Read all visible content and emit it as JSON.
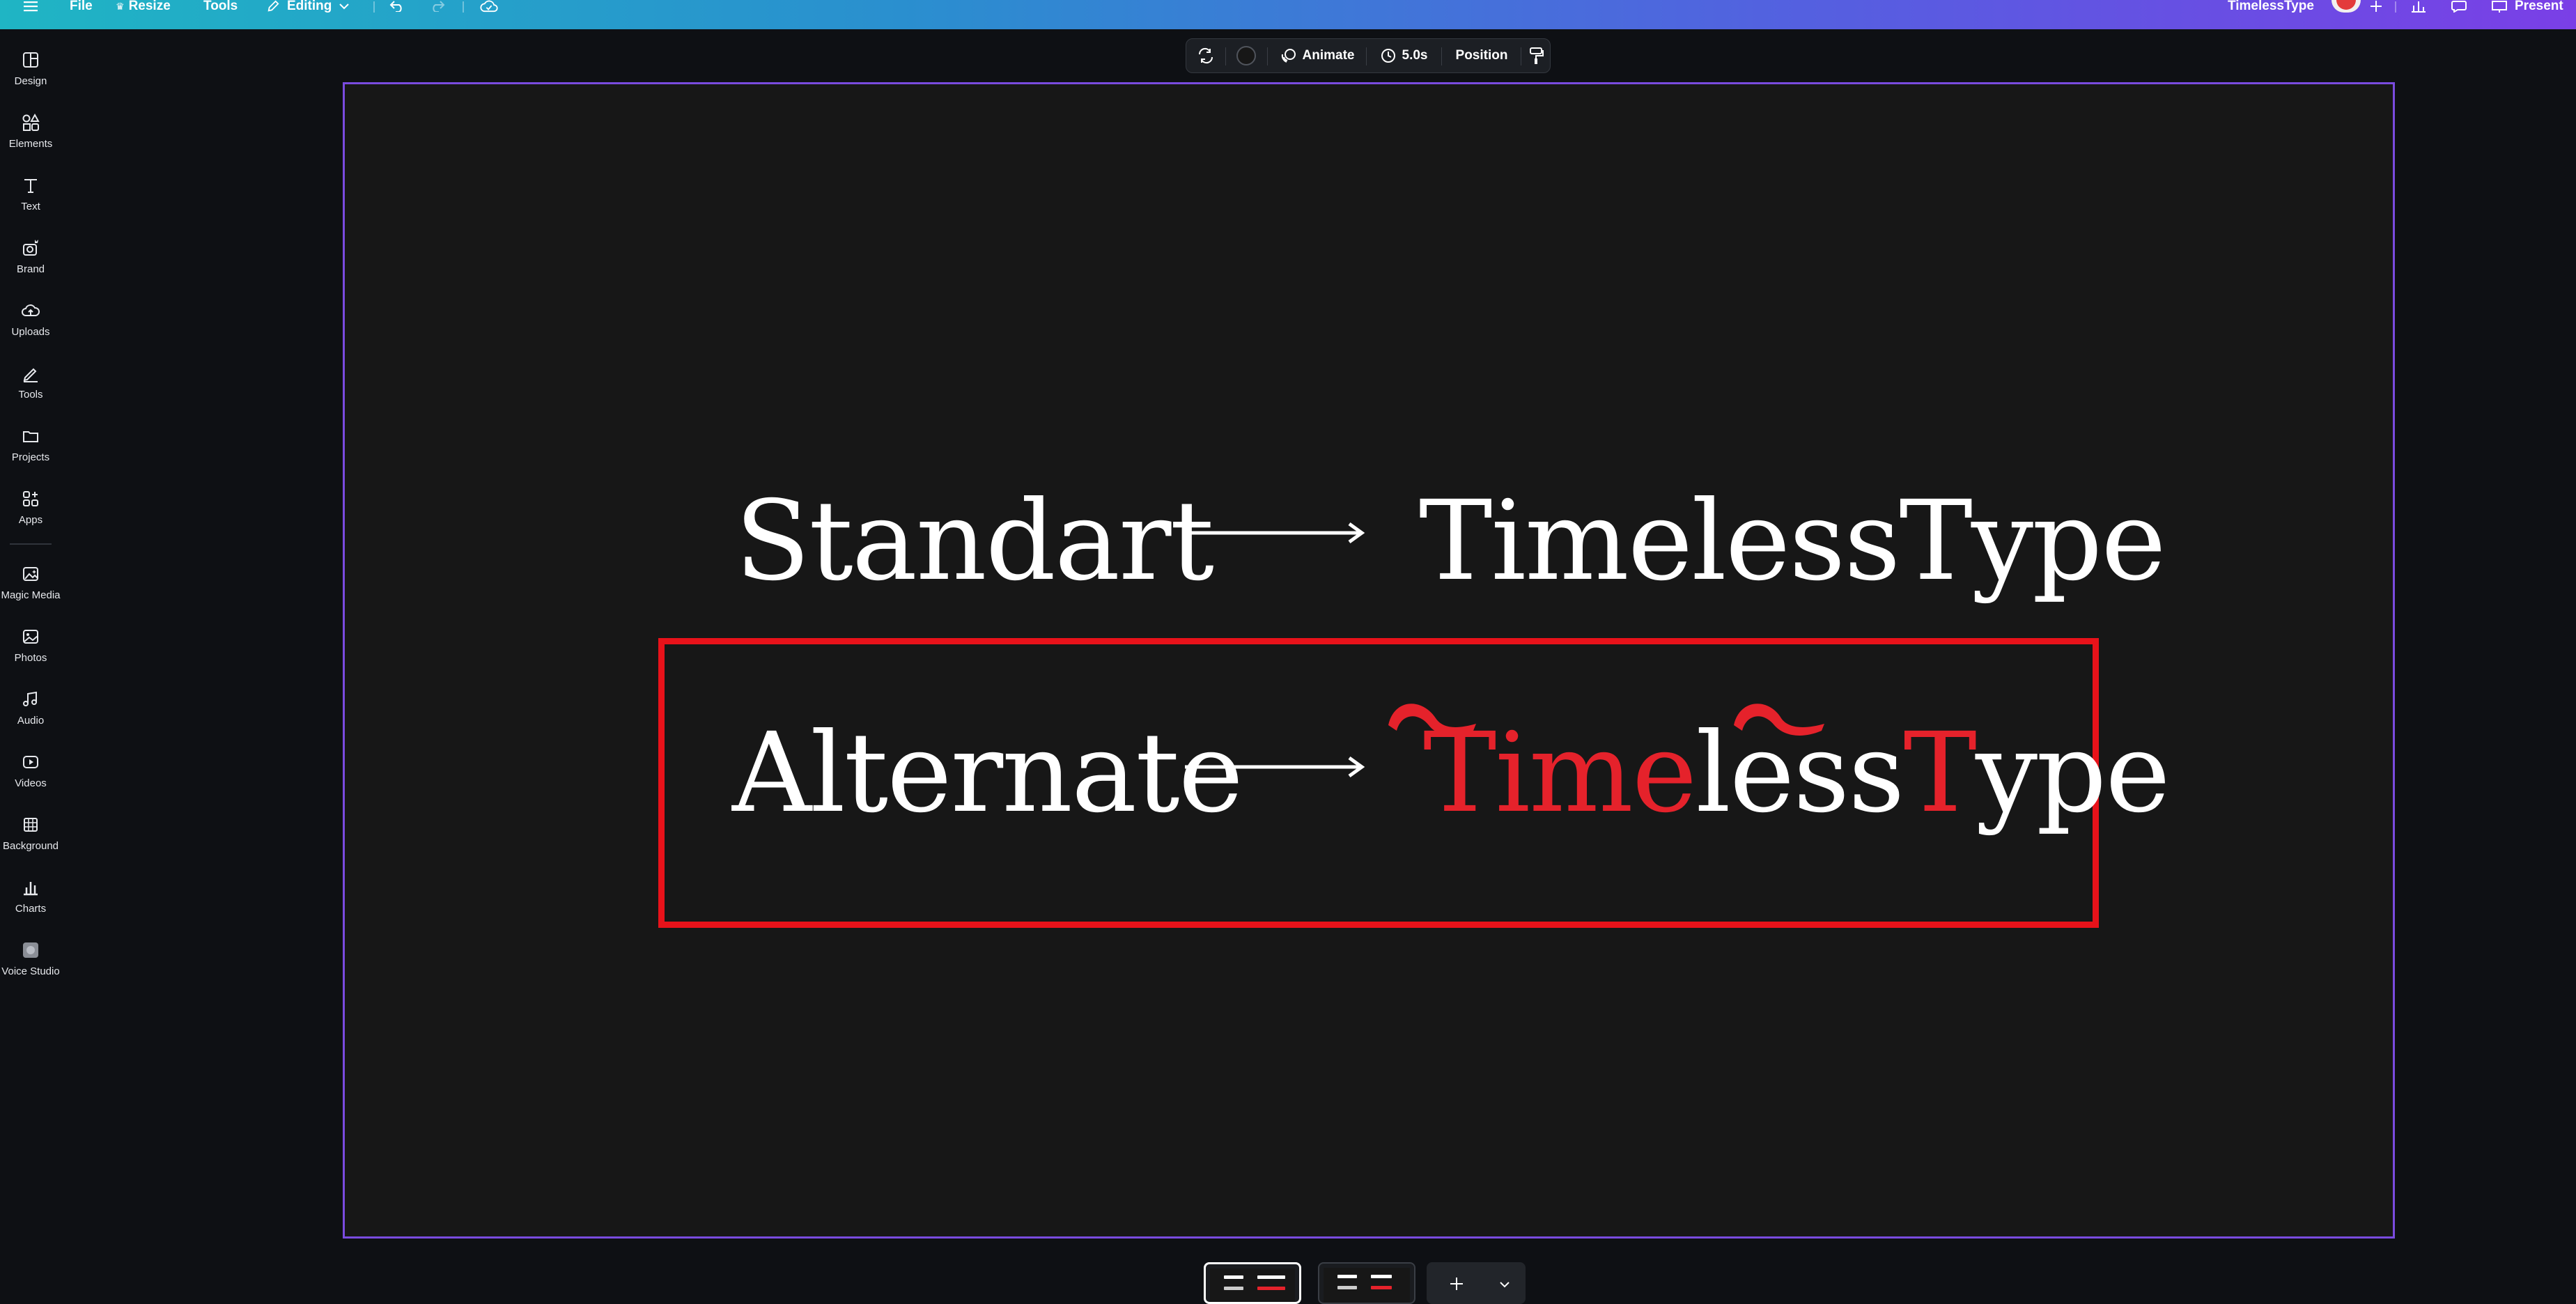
{
  "topbar": {
    "menu_icon": "hamburger-icon",
    "file_label": "File",
    "resize_label": "Resize",
    "tools_label": "Tools",
    "editing_label": "Editing",
    "design_title": "TimelessType",
    "present_label": "Present"
  },
  "sidebar": {
    "items": [
      {
        "label": "Design",
        "icon": "design-icon"
      },
      {
        "label": "Elements",
        "icon": "elements-icon"
      },
      {
        "label": "Text",
        "icon": "text-icon"
      },
      {
        "label": "Brand",
        "icon": "brand-icon"
      },
      {
        "label": "Uploads",
        "icon": "uploads-icon"
      },
      {
        "label": "Tools",
        "icon": "tools-icon"
      },
      {
        "label": "Projects",
        "icon": "projects-icon"
      },
      {
        "label": "Apps",
        "icon": "apps-icon"
      },
      {
        "label": "Magic Media",
        "icon": "magic-media-icon"
      },
      {
        "label": "Photos",
        "icon": "photos-icon"
      },
      {
        "label": "Audio",
        "icon": "audio-icon"
      },
      {
        "label": "Videos",
        "icon": "videos-icon"
      },
      {
        "label": "Background",
        "icon": "background-icon"
      },
      {
        "label": "Charts",
        "icon": "charts-icon"
      },
      {
        "label": "Voice Studio",
        "icon": "voice-studio-icon"
      }
    ]
  },
  "floating_toolbar": {
    "animate_label": "Animate",
    "duration_label": "5.0s",
    "position_label": "Position"
  },
  "slide": {
    "row1_left": "Standart",
    "row1_right": "TimelessType",
    "row2_left": "Alternate",
    "row2_right_parts": [
      {
        "text": "Ti",
        "color": "red"
      },
      {
        "text": "m",
        "color": "red"
      },
      {
        "text": "e",
        "color": "red"
      },
      {
        "text": "less",
        "color": "white"
      },
      {
        "text": "T",
        "color": "red"
      },
      {
        "text": "ype",
        "color": "white"
      }
    ],
    "accent_color": "#e8121a",
    "background_color": "#171717"
  },
  "thumbnails": {
    "count": 2,
    "active_index": 0
  },
  "colors": {
    "page_border": "#7a4bdf",
    "topbar_gradient_start": "#1fb5c4",
    "topbar_gradient_end": "#7a3fe6"
  }
}
